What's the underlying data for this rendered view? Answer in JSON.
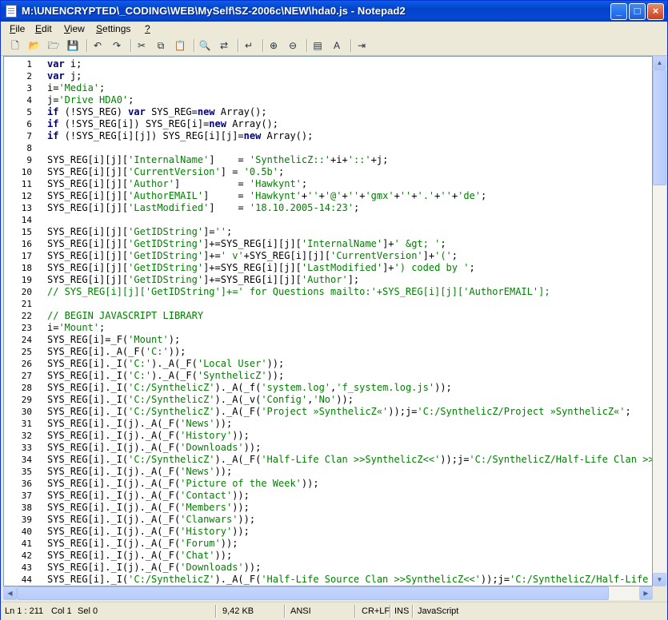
{
  "window": {
    "title": "M:\\UNENCRYPTED\\_CODING\\WEB\\MySelf\\SZ-2006c\\NEW\\hda0.js - Notepad2",
    "controls": {
      "minimize": "_",
      "maximize": "□",
      "close": "×"
    }
  },
  "menu": [
    {
      "label": "File",
      "u": "F",
      "rest": "ile"
    },
    {
      "label": "Edit",
      "u": "E",
      "rest": "dit"
    },
    {
      "label": "View",
      "u": "V",
      "rest": "iew"
    },
    {
      "label": "Settings",
      "u": "S",
      "rest": "ettings"
    },
    {
      "label": "?",
      "u": "?",
      "rest": ""
    }
  ],
  "toolbar": [
    "new-file-icon",
    "open-folder-icon",
    "browse-icon",
    "save-icon",
    "sep",
    "undo-icon",
    "redo-icon",
    "sep",
    "cut-icon",
    "copy-icon",
    "paste-icon",
    "sep",
    "find-icon",
    "replace-icon",
    "sep",
    "word-wrap-icon",
    "sep",
    "zoom-in-icon",
    "zoom-out-icon",
    "sep",
    "scheme-icon",
    "font-icon",
    "sep",
    "exit-icon"
  ],
  "colors": {
    "keyword": "#000080",
    "string": "#008000",
    "comment": "#008000",
    "text": "#000000"
  },
  "code": {
    "lines": [
      [
        [
          "k",
          "var"
        ],
        [
          "t",
          " i;"
        ]
      ],
      [
        [
          "k",
          "var"
        ],
        [
          "t",
          " j;"
        ]
      ],
      [
        [
          "t",
          "i="
        ],
        [
          "s",
          "'Media'"
        ],
        [
          "t",
          ";"
        ]
      ],
      [
        [
          "t",
          "j="
        ],
        [
          "s",
          "'Drive HDA0'"
        ],
        [
          "t",
          ";"
        ]
      ],
      [
        [
          "k",
          "if"
        ],
        [
          "t",
          " (!SYS_REG) "
        ],
        [
          "k",
          "var"
        ],
        [
          "t",
          " SYS_REG="
        ],
        [
          "k",
          "new"
        ],
        [
          "t",
          " Array();"
        ]
      ],
      [
        [
          "k",
          "if"
        ],
        [
          "t",
          " (!SYS_REG[i]) SYS_REG[i]="
        ],
        [
          "k",
          "new"
        ],
        [
          "t",
          " Array();"
        ]
      ],
      [
        [
          "k",
          "if"
        ],
        [
          "t",
          " (!SYS_REG[i][j]) SYS_REG[i][j]="
        ],
        [
          "k",
          "new"
        ],
        [
          "t",
          " Array();"
        ]
      ],
      [],
      [
        [
          "t",
          "SYS_REG[i][j]["
        ],
        [
          "s",
          "'InternalName'"
        ],
        [
          "t",
          "]    = "
        ],
        [
          "s",
          "'SynthelicZ::'"
        ],
        [
          "t",
          "+i+"
        ],
        [
          "s",
          "'::'"
        ],
        [
          "t",
          "+j;"
        ]
      ],
      [
        [
          "t",
          "SYS_REG[i][j]["
        ],
        [
          "s",
          "'CurrentVersion'"
        ],
        [
          "t",
          "] = "
        ],
        [
          "s",
          "'0.5b'"
        ],
        [
          "t",
          ";"
        ]
      ],
      [
        [
          "t",
          "SYS_REG[i][j]["
        ],
        [
          "s",
          "'Author'"
        ],
        [
          "t",
          "]          = "
        ],
        [
          "s",
          "'Hawkynt'"
        ],
        [
          "t",
          ";"
        ]
      ],
      [
        [
          "t",
          "SYS_REG[i][j]["
        ],
        [
          "s",
          "'AuthorEMAIL'"
        ],
        [
          "t",
          "]     = "
        ],
        [
          "s",
          "'Hawkynt'"
        ],
        [
          "t",
          "+"
        ],
        [
          "s",
          "''"
        ],
        [
          "t",
          "+"
        ],
        [
          "s",
          "'@'"
        ],
        [
          "t",
          "+"
        ],
        [
          "s",
          "''"
        ],
        [
          "t",
          "+"
        ],
        [
          "s",
          "'gmx'"
        ],
        [
          "t",
          "+"
        ],
        [
          "s",
          "''"
        ],
        [
          "t",
          "+"
        ],
        [
          "s",
          "'.'"
        ],
        [
          "t",
          "+"
        ],
        [
          "s",
          "''"
        ],
        [
          "t",
          "+"
        ],
        [
          "s",
          "'de'"
        ],
        [
          "t",
          ";"
        ]
      ],
      [
        [
          "t",
          "SYS_REG[i][j]["
        ],
        [
          "s",
          "'LastModified'"
        ],
        [
          "t",
          "]    = "
        ],
        [
          "s",
          "'18.10.2005-14:23'"
        ],
        [
          "t",
          ";"
        ]
      ],
      [],
      [
        [
          "t",
          "SYS_REG[i][j]["
        ],
        [
          "s",
          "'GetIDString'"
        ],
        [
          "t",
          "]="
        ],
        [
          "s",
          "''"
        ],
        [
          "t",
          ";"
        ]
      ],
      [
        [
          "t",
          "SYS_REG[i][j]["
        ],
        [
          "s",
          "'GetIDString'"
        ],
        [
          "t",
          "]+=SYS_REG[i][j]["
        ],
        [
          "s",
          "'InternalName'"
        ],
        [
          "t",
          "]+"
        ],
        [
          "s",
          "' &gt; '"
        ],
        [
          "t",
          ";"
        ]
      ],
      [
        [
          "t",
          "SYS_REG[i][j]["
        ],
        [
          "s",
          "'GetIDString'"
        ],
        [
          "t",
          "]+="
        ],
        [
          "s",
          "' v'"
        ],
        [
          "t",
          "+SYS_REG[i][j]["
        ],
        [
          "s",
          "'CurrentVersion'"
        ],
        [
          "t",
          "]+"
        ],
        [
          "s",
          "'('"
        ],
        [
          "t",
          ";"
        ]
      ],
      [
        [
          "t",
          "SYS_REG[i][j]["
        ],
        [
          "s",
          "'GetIDString'"
        ],
        [
          "t",
          "]+=SYS_REG[i][j]["
        ],
        [
          "s",
          "'LastModified'"
        ],
        [
          "t",
          "]+"
        ],
        [
          "s",
          "') coded by '"
        ],
        [
          "t",
          ";"
        ]
      ],
      [
        [
          "t",
          "SYS_REG[i][j]["
        ],
        [
          "s",
          "'GetIDString'"
        ],
        [
          "t",
          "]+=SYS_REG[i][j]["
        ],
        [
          "s",
          "'Author'"
        ],
        [
          "t",
          "];"
        ]
      ],
      [
        [
          "c",
          "// SYS_REG[i][j]['GetIDString']+=' for Questions mailto:'+SYS_REG[i][j]['AuthorEMAIL'];"
        ]
      ],
      [],
      [
        [
          "c",
          "// BEGIN JAVASCRIPT LIBRARY"
        ]
      ],
      [
        [
          "t",
          "i="
        ],
        [
          "s",
          "'Mount'"
        ],
        [
          "t",
          ";"
        ]
      ],
      [
        [
          "t",
          "SYS_REG[i]=_F("
        ],
        [
          "s",
          "'Mount'"
        ],
        [
          "t",
          ");"
        ]
      ],
      [
        [
          "t",
          "SYS_REG[i]._A(_F("
        ],
        [
          "s",
          "'C:'"
        ],
        [
          "t",
          "));"
        ]
      ],
      [
        [
          "t",
          "SYS_REG[i]._I("
        ],
        [
          "s",
          "'C:'"
        ],
        [
          "t",
          ")._A(_F("
        ],
        [
          "s",
          "'Local User'"
        ],
        [
          "t",
          "));"
        ]
      ],
      [
        [
          "t",
          "SYS_REG[i]._I("
        ],
        [
          "s",
          "'C:'"
        ],
        [
          "t",
          ")._A(_F("
        ],
        [
          "s",
          "'SynthelicZ'"
        ],
        [
          "t",
          "));"
        ]
      ],
      [
        [
          "t",
          "SYS_REG[i]._I("
        ],
        [
          "s",
          "'C:/SynthelicZ'"
        ],
        [
          "t",
          ")._A(_f("
        ],
        [
          "s",
          "'system.log'"
        ],
        [
          "t",
          ","
        ],
        [
          "s",
          "'f_system.log.js'"
        ],
        [
          "t",
          "));"
        ]
      ],
      [
        [
          "t",
          "SYS_REG[i]._I("
        ],
        [
          "s",
          "'C:/SynthelicZ'"
        ],
        [
          "t",
          ")._A(_v("
        ],
        [
          "s",
          "'Config'"
        ],
        [
          "t",
          ","
        ],
        [
          "s",
          "'No'"
        ],
        [
          "t",
          "));"
        ]
      ],
      [
        [
          "t",
          "SYS_REG[i]._I("
        ],
        [
          "s",
          "'C:/SynthelicZ'"
        ],
        [
          "t",
          ")._A(_F("
        ],
        [
          "s",
          "'Project »SynthelicZ«'"
        ],
        [
          "t",
          "));j="
        ],
        [
          "s",
          "'C:/SynthelicZ/Project »SynthelicZ«'"
        ],
        [
          "t",
          ";"
        ]
      ],
      [
        [
          "t",
          "SYS_REG[i]._I(j)._A(_F("
        ],
        [
          "s",
          "'News'"
        ],
        [
          "t",
          "));"
        ]
      ],
      [
        [
          "t",
          "SYS_REG[i]._I(j)._A(_F("
        ],
        [
          "s",
          "'History'"
        ],
        [
          "t",
          "));"
        ]
      ],
      [
        [
          "t",
          "SYS_REG[i]._I(j)._A(_F("
        ],
        [
          "s",
          "'Downloads'"
        ],
        [
          "t",
          "));"
        ]
      ],
      [
        [
          "t",
          "SYS_REG[i]._I("
        ],
        [
          "s",
          "'C:/SynthelicZ'"
        ],
        [
          "t",
          ")._A(_F("
        ],
        [
          "s",
          "'Half-Life Clan >>SynthelicZ<<'"
        ],
        [
          "t",
          "));j="
        ],
        [
          "s",
          "'C:/SynthelicZ/Half-Life Clan >>SynthelicZ<<'"
        ],
        [
          "t",
          ";"
        ]
      ],
      [
        [
          "t",
          "SYS_REG[i]._I(j)._A(_F("
        ],
        [
          "s",
          "'News'"
        ],
        [
          "t",
          "));"
        ]
      ],
      [
        [
          "t",
          "SYS_REG[i]._I(j)._A(_F("
        ],
        [
          "s",
          "'Picture of the Week'"
        ],
        [
          "t",
          "));"
        ]
      ],
      [
        [
          "t",
          "SYS_REG[i]._I(j)._A(_F("
        ],
        [
          "s",
          "'Contact'"
        ],
        [
          "t",
          "));"
        ]
      ],
      [
        [
          "t",
          "SYS_REG[i]._I(j)._A(_F("
        ],
        [
          "s",
          "'Members'"
        ],
        [
          "t",
          "));"
        ]
      ],
      [
        [
          "t",
          "SYS_REG[i]._I(j)._A(_F("
        ],
        [
          "s",
          "'Clanwars'"
        ],
        [
          "t",
          "));"
        ]
      ],
      [
        [
          "t",
          "SYS_REG[i]._I(j)._A(_F("
        ],
        [
          "s",
          "'History'"
        ],
        [
          "t",
          "));"
        ]
      ],
      [
        [
          "t",
          "SYS_REG[i]._I(j)._A(_F("
        ],
        [
          "s",
          "'Forum'"
        ],
        [
          "t",
          "));"
        ]
      ],
      [
        [
          "t",
          "SYS_REG[i]._I(j)._A(_F("
        ],
        [
          "s",
          "'Chat'"
        ],
        [
          "t",
          "));"
        ]
      ],
      [
        [
          "t",
          "SYS_REG[i]._I(j)._A(_F("
        ],
        [
          "s",
          "'Downloads'"
        ],
        [
          "t",
          "));"
        ]
      ],
      [
        [
          "t",
          "SYS_REG[i]._I("
        ],
        [
          "s",
          "'C:/SynthelicZ'"
        ],
        [
          "t",
          ")._A(_F("
        ],
        [
          "s",
          "'Half-Life Source Clan >>SynthelicZ<<'"
        ],
        [
          "t",
          "));j="
        ],
        [
          "s",
          "'C:/SynthelicZ/Half-Life Source Clan >>SynthelicZ<<'"
        ],
        [
          "t",
          ";"
        ]
      ]
    ]
  },
  "status": {
    "position": "Ln 1 : 211",
    "col": "Col 1",
    "sel": "Sel 0",
    "size": "9,42 KB",
    "encoding": "ANSI",
    "eol": "CR+LF",
    "mode": "INS",
    "lexer": "JavaScript"
  }
}
